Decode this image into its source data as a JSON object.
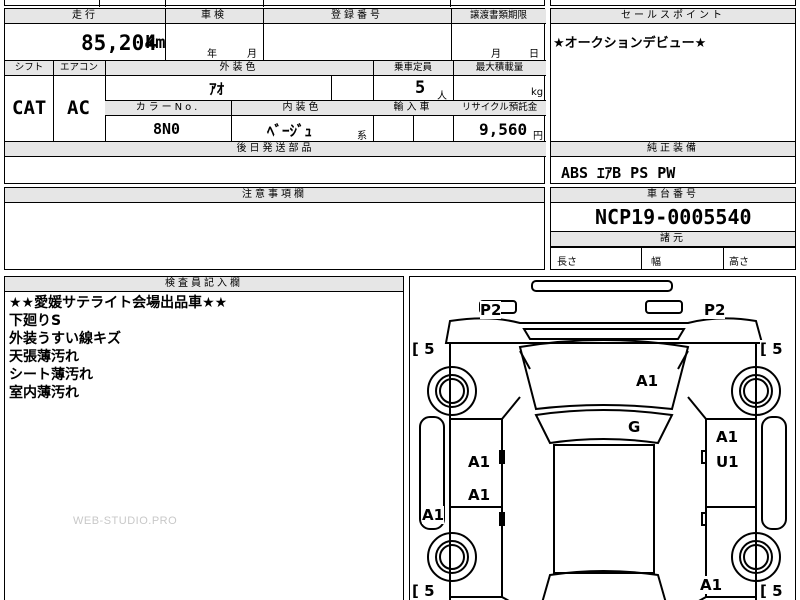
{
  "top_row_fragments": [
    "",
    "",
    "",
    "車検",
    "",
    ""
  ],
  "mileage": {
    "header": "走行",
    "value": "85,204",
    "unit": "km"
  },
  "inspection": {
    "header": "車検",
    "year_unit": "年",
    "month_unit": "月"
  },
  "registration": {
    "header": "登録番号",
    "value": ""
  },
  "transfer_deadline": {
    "header": "譲渡書類期限",
    "month_unit": "月",
    "day_unit": "日"
  },
  "selling_point": {
    "header": "セールスポイント",
    "text": "★オークションデビュー★"
  },
  "shift": {
    "header": "シフト",
    "value": "CAT"
  },
  "aircon": {
    "header": "エアコン",
    "value": "AC"
  },
  "exterior_color": {
    "header": "外装色",
    "value": "ｱｵ"
  },
  "capacity": {
    "header": "乗車定員",
    "value": "5",
    "unit": "人"
  },
  "max_load": {
    "header": "最大積載量",
    "value": "",
    "unit": "kg"
  },
  "color_no": {
    "header": "カラーNo.",
    "value": "8N0"
  },
  "interior_color": {
    "header": "内装色",
    "value": "ﾍﾞｰｼﾞｭ",
    "suffix": "系"
  },
  "import_car": {
    "header": "輸入車",
    "value": ""
  },
  "recycle_fee": {
    "header": "リサイクル預託金",
    "value": "9,560",
    "unit": "円"
  },
  "later_parts": {
    "header": "後日発送部品",
    "value": ""
  },
  "standard_equipment": {
    "header": "純正装備",
    "value": "ABS ｴｱB PS PW"
  },
  "caution": {
    "header": "注意事項欄",
    "value": ""
  },
  "chassis": {
    "header": "車台番号",
    "value": "NCP19-0005540"
  },
  "dimensions": {
    "header": "諸元",
    "length_label": "長さ",
    "width_label": "幅",
    "height_label": "高さ"
  },
  "inspector": {
    "header": "検査員記入欄",
    "notes": [
      "★★愛媛サテライト会場出品車★★",
      "下廻りS",
      "外装うすい線キズ",
      "天張薄汚れ",
      "シート薄汚れ",
      "室内薄汚れ"
    ]
  },
  "watermark": "WEB-STUDIO.PRO",
  "diagram": {
    "p2_left": "P2",
    "p2_right": "P2",
    "tire_fl": "[ 5",
    "tire_fr": "[ 5",
    "tire_rl": "[ 5",
    "tire_rr": "[ 5",
    "hood": "A1",
    "windshield": "G",
    "left_front_door": "A1",
    "left_rear_door": "A1",
    "left_sill": "A1",
    "right_front_door": "A1",
    "right_rear_door": "U1",
    "rear_right": "A1"
  }
}
